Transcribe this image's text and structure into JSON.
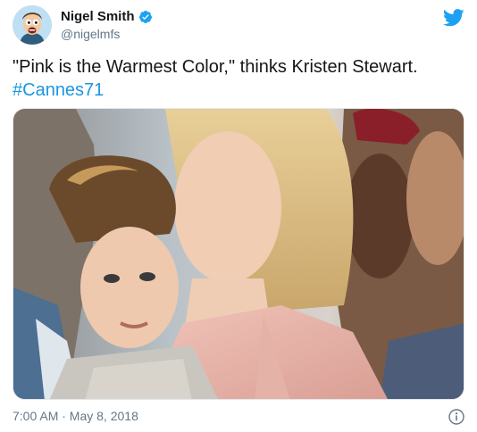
{
  "author": {
    "display_name": "Nigel Smith",
    "handle": "@nigelmfs",
    "verified": true,
    "avatar_icon": "cartoon-avatar"
  },
  "tweet": {
    "text": "\"Pink is the Warmest Color,\" thinks Kristen Stewart.",
    "hashtag": "#Cannes71",
    "timestamp": "7:00 AM · May 8, 2018"
  },
  "icons": {
    "brand": "twitter-bird-icon",
    "info": "info-icon",
    "verified": "verified-badge-icon"
  },
  "colors": {
    "brand_blue": "#1da1f2",
    "link_blue": "#1b95e0",
    "secondary_text": "#657786",
    "primary_text": "#14171a"
  }
}
